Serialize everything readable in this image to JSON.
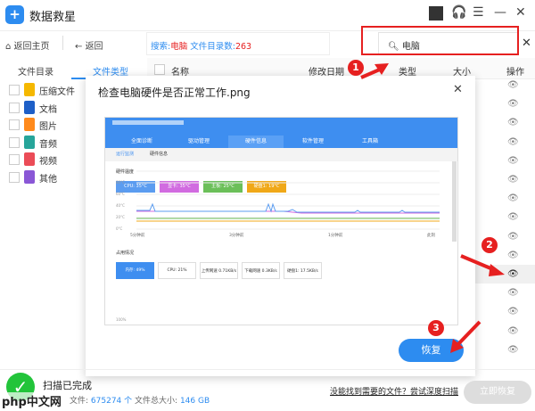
{
  "app": {
    "title": "数据救星",
    "logo_glyph": "+"
  },
  "window": {
    "icons": [
      "headset-icon",
      "menu-icon",
      "minimize-icon",
      "close-icon"
    ]
  },
  "toolbar": {
    "home": "返回主页",
    "back": "返回",
    "search_label": "搜索:",
    "search_term": "电脑",
    "dir_count_label": "文件目录数:",
    "dir_count": "263",
    "search_value": "电脑",
    "clear": "✕"
  },
  "tabs": [
    {
      "label": "文件目录"
    },
    {
      "label": "文件类型",
      "active": true
    }
  ],
  "columns": {
    "name": "名称",
    "date": "修改日期",
    "type": "类型",
    "size": "大小",
    "action": "操作"
  },
  "sidebar": {
    "items": [
      {
        "label": "压缩文件",
        "color": "#f5b800"
      },
      {
        "label": "文档",
        "color": "#1e5fc7"
      },
      {
        "label": "图片",
        "color": "#ff8a1c"
      },
      {
        "label": "音频",
        "color": "#27a59a"
      },
      {
        "label": "视频",
        "color": "#eb4c57"
      },
      {
        "label": "其他",
        "color": "#8a57d6"
      }
    ]
  },
  "modal": {
    "title": "检查电脑硬件是否正常工作.png",
    "close": "✕",
    "restore": "恢复",
    "shot": {
      "nav": [
        "全面诊断",
        "驱动管理",
        "硬件信息",
        "软件管理",
        "工具箱"
      ],
      "subtabs": [
        "运行监测",
        "硬件信息"
      ],
      "temp_title": "硬件温度",
      "temps": [
        {
          "label": "CPU: 35°C",
          "color": "#5b9cf0"
        },
        {
          "label": "显卡: 35°C",
          "color": "#d16be0"
        },
        {
          "label": "主板: 25°C",
          "color": "#6bbf59"
        },
        {
          "label": "硬盘1: 19°C",
          "color": "#f0a818"
        }
      ],
      "yticks": [
        "100°C",
        "80°C",
        "60°C",
        "40°C",
        "20°C",
        "0°C"
      ],
      "xticks": [
        "5分钟前",
        "3分钟前",
        "1分钟前",
        "此刻"
      ],
      "usage_title": "占用情况",
      "usage": [
        "内存: 49%",
        "CPU: 21%",
        "上传网速 0.71KB/s",
        "下载网速 0.3KB/s",
        "硬盘1: 17.5KB/s"
      ],
      "bottom_tick": "100%"
    }
  },
  "status": {
    "title": "扫描已完成",
    "files_label": "文件:",
    "files": "675274 个",
    "size_label": "文件总大小:",
    "size": "146 GB",
    "deep_scan_link": "没能找到需要的文件？尝试深度扫描",
    "recover_now": "立即恢复",
    "watermark": "php中文网"
  },
  "annotations": [
    "1",
    "2",
    "3"
  ],
  "colors": {
    "accent": "#2d8cf0",
    "highlight": "#e62020"
  }
}
